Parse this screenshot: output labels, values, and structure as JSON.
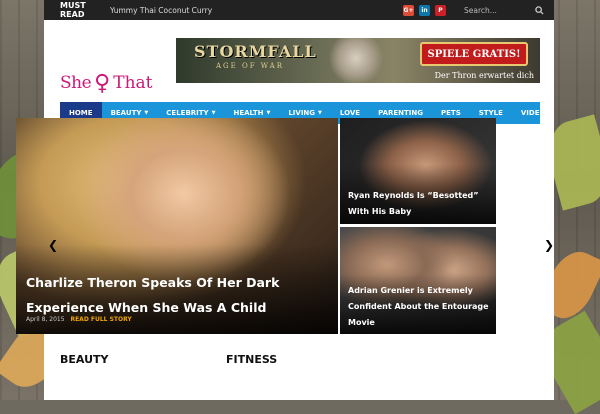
{
  "topbar": {
    "must_read": "MUST READ",
    "ticker": "Yummy Thai Coconut Curry",
    "social": [
      "G+",
      "in",
      "P"
    ],
    "search_placeholder": "Search..."
  },
  "logo": {
    "part1": "She",
    "part2": "♀",
    "part3": "That"
  },
  "banner": {
    "title": "STORMFALL",
    "subtitle": "AGE OF WAR",
    "button": "SPIELE GRATIS!",
    "tagline": "Der Thron erwartet dich"
  },
  "nav": {
    "items": [
      {
        "label": "HOME",
        "active": true
      },
      {
        "label": "BEAUTY",
        "dropdown": true
      },
      {
        "label": "CELEBRITY",
        "dropdown": true
      },
      {
        "label": "HEALTH",
        "dropdown": true
      },
      {
        "label": "LIVING",
        "dropdown": true
      },
      {
        "label": "LOVE"
      },
      {
        "label": "PARENTING"
      },
      {
        "label": "PETS"
      },
      {
        "label": "STYLE"
      },
      {
        "label": "VIDEOS"
      }
    ]
  },
  "featured": {
    "main_title": "Charlize Theron Speaks Of Her Dark Experience When She Was A Child",
    "main_date": "April 8, 2015",
    "main_read_more": "READ FULL STORY",
    "side1_title": "Ryan Reynolds Is “Besotted” With His Baby",
    "side2_title": "Adrian Grenier is Extremely Confident About the Entourage Movie"
  },
  "arrows": {
    "left": "❮",
    "right": "❯"
  },
  "sections": {
    "beauty": "BEAUTY",
    "fitness": "FITNESS"
  }
}
